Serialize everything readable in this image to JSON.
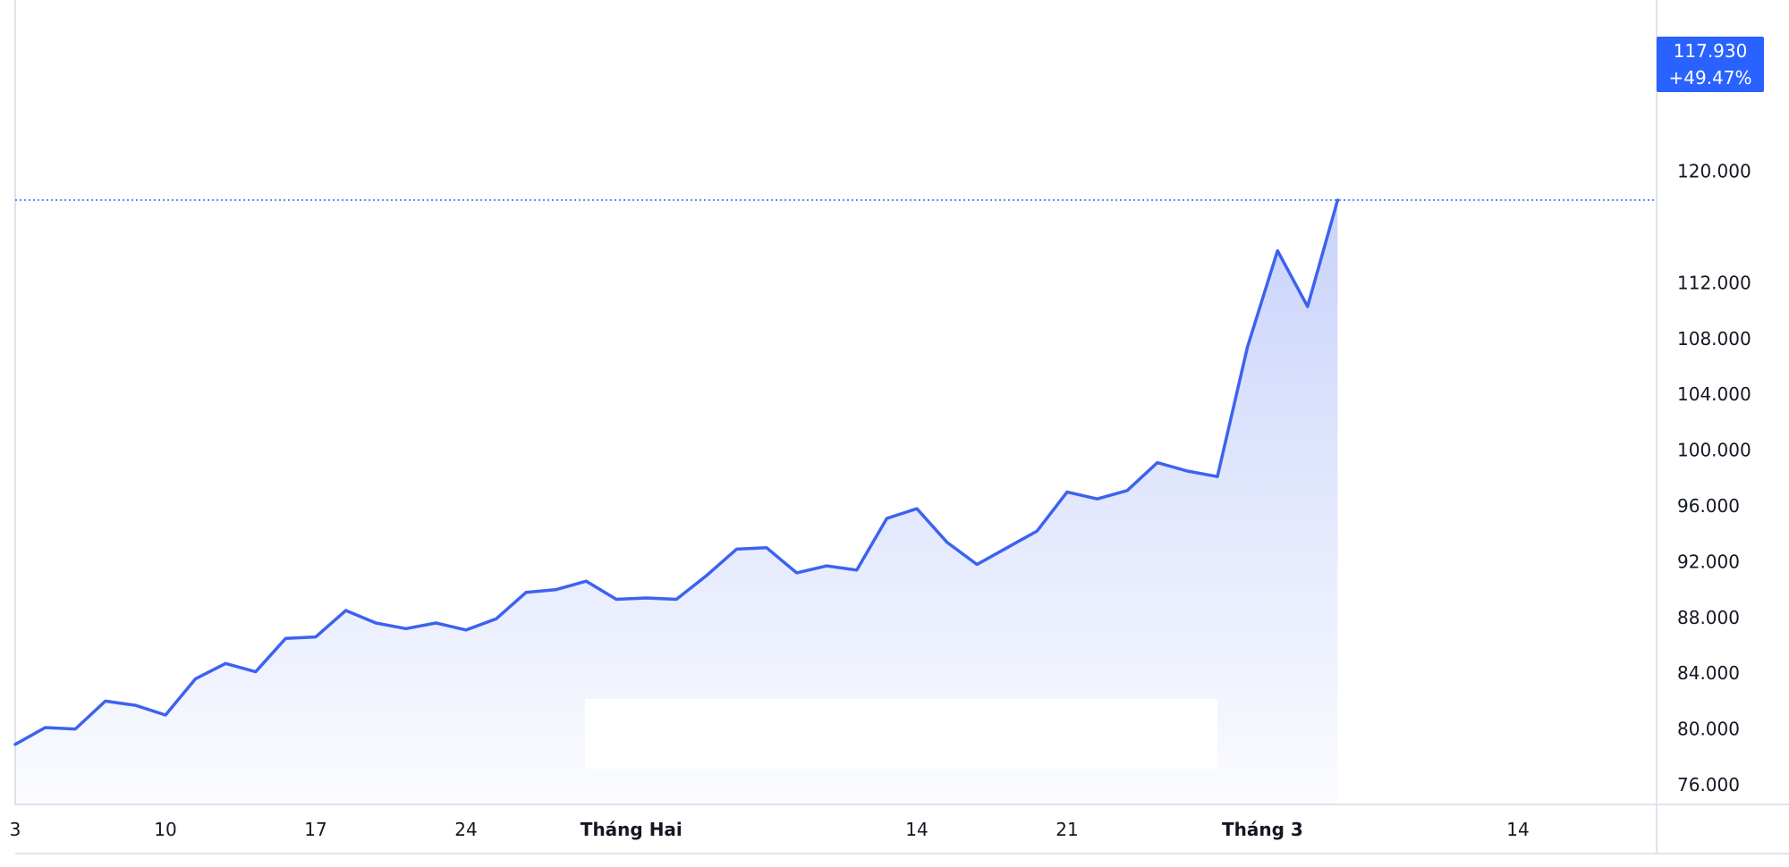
{
  "chart_data": {
    "type": "area",
    "title": "",
    "xlabel": "",
    "ylabel": "",
    "ylim": [
      74000,
      120000
    ],
    "y_ticks": [
      "76.000",
      "80.000",
      "84.000",
      "88.000",
      "92.000",
      "96.000",
      "100.000",
      "104.000",
      "108.000",
      "112.000",
      "120.000"
    ],
    "x_ticks": [
      {
        "label": "3",
        "bold": false
      },
      {
        "label": "10",
        "bold": false
      },
      {
        "label": "17",
        "bold": false
      },
      {
        "label": "24",
        "bold": false
      },
      {
        "label": "Tháng Hai",
        "bold": true
      },
      {
        "label": "14",
        "bold": false
      },
      {
        "label": "21",
        "bold": false
      },
      {
        "label": "Tháng 3",
        "bold": true
      },
      {
        "label": "14",
        "bold": false
      }
    ],
    "grid": false,
    "series": [
      {
        "values": [
          78900,
          80100,
          80000,
          82000,
          81700,
          81000,
          83600,
          84700,
          84100,
          86500,
          86600,
          88500,
          87600,
          87200,
          87600,
          87100,
          87900,
          89800,
          90000,
          90600,
          89300,
          89400,
          89300,
          91000,
          92900,
          93000,
          91200,
          91700,
          91400,
          95100,
          95800,
          93400,
          91800,
          93000,
          94200,
          97000,
          96500,
          97100,
          99100,
          98500,
          98100,
          107400,
          114300,
          110300,
          117930
        ]
      }
    ],
    "last_value_label": "117.930",
    "change_label": "+49.47%",
    "line_color": "#3d62f0",
    "badge_color": "#2962ff"
  }
}
